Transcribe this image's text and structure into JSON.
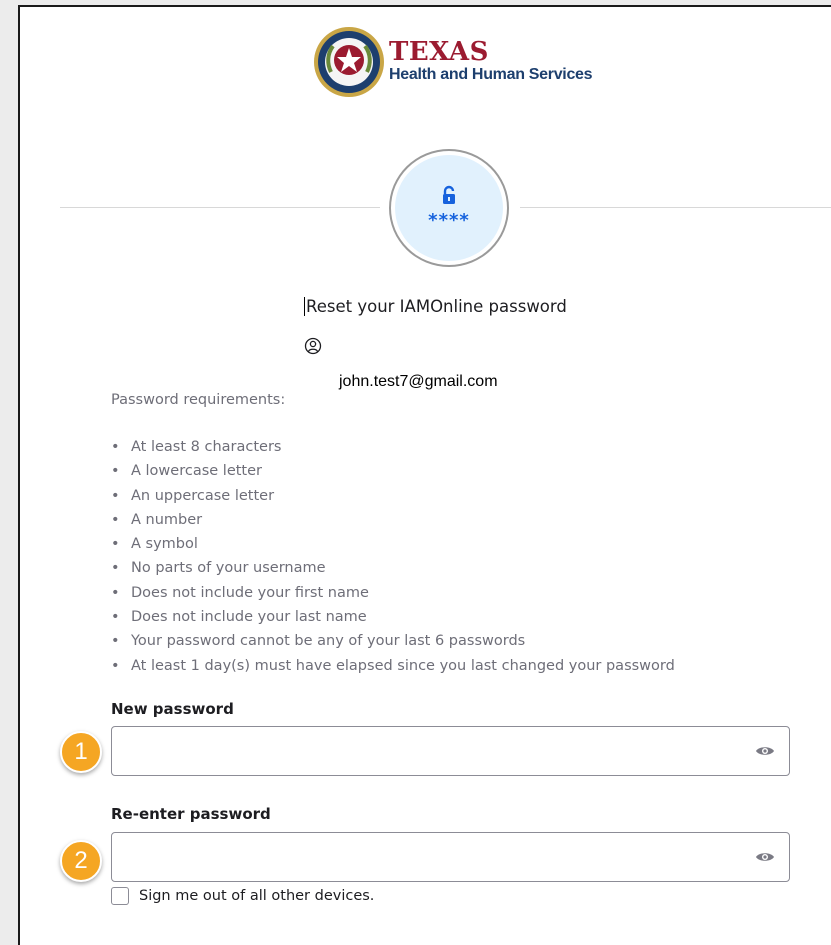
{
  "logo": {
    "line1": "TEXAS",
    "line2": "Health and Human Services",
    "icon": "texas-seal-icon"
  },
  "badge": {
    "icon": "unlock-icon",
    "text": "****",
    "color": "#1662dd"
  },
  "title": "Reset your IAMOnline password",
  "user": {
    "icon": "user-circle-icon",
    "email": "john.test7@gmail.com"
  },
  "requirements": {
    "heading": "Password requirements:",
    "items": [
      "At least 8 characters",
      "A lowercase letter",
      "An uppercase letter",
      "A number",
      "A symbol",
      "No parts of your username",
      "Does not include your first name",
      "Does not include your last name",
      "Your password cannot be any of your last 6 passwords",
      "At least 1 day(s) must have elapsed since you last changed your password"
    ]
  },
  "fields": {
    "new_password": {
      "label": "New password",
      "value": "",
      "step": "1"
    },
    "reenter_password": {
      "label": "Re-enter password",
      "value": "",
      "step": "2"
    }
  },
  "signout": {
    "label": "Sign me out of all other devices.",
    "checked": false
  },
  "colors": {
    "brand_red": "#9b1b30",
    "brand_navy": "#1d3f6e",
    "step_badge": "#f5a623"
  }
}
